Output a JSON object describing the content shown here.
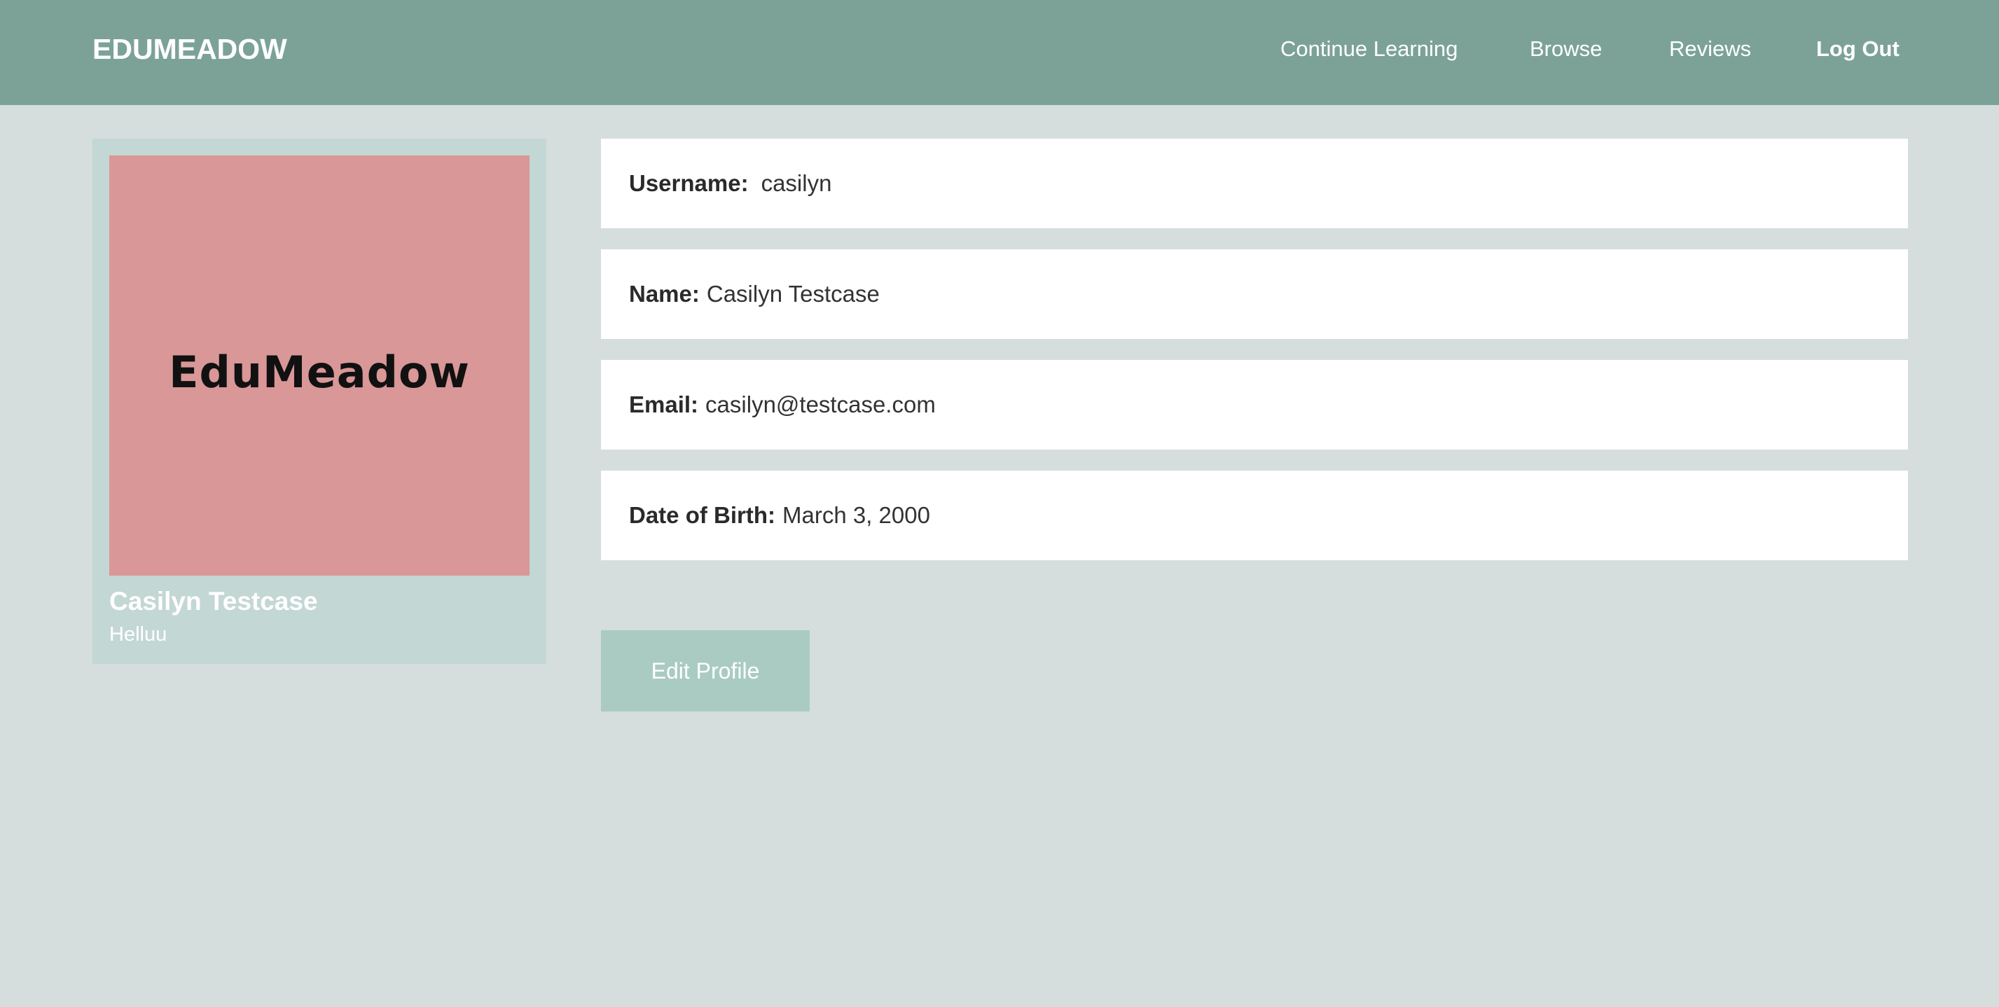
{
  "navbar": {
    "brand": "EDUMEADOW",
    "links": {
      "continue_learning": "Continue Learning",
      "browse": "Browse",
      "reviews": "Reviews",
      "log_out": "Log Out"
    }
  },
  "profile": {
    "image_text": "EduMeadow",
    "name": "Casilyn Testcase",
    "bio": "Helluu"
  },
  "fields": {
    "username": {
      "label": "Username:",
      "value": "casilyn"
    },
    "name": {
      "label": "Name:",
      "value": "Casilyn Testcase"
    },
    "email": {
      "label": "Email:",
      "value": "casilyn@testcase.com"
    },
    "dob": {
      "label": "Date of Birth:",
      "value": "March 3, 2000"
    }
  },
  "actions": {
    "edit_profile": "Edit Profile"
  },
  "colors": {
    "navbar_bg": "#7ca298",
    "page_bg": "#d5dedd",
    "card_bg": "#c3d7d4",
    "profile_image_bg": "#d99797",
    "button_bg": "#a9cbc2"
  }
}
